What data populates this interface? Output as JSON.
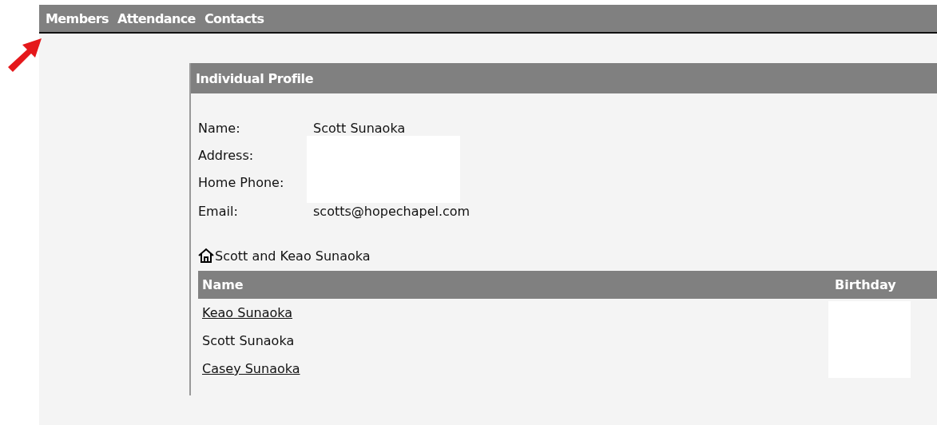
{
  "nav": [
    {
      "label": "Members"
    },
    {
      "label": "Attendance"
    },
    {
      "label": "Contacts"
    }
  ],
  "panel": {
    "title": "Individual Profile",
    "fields": [
      {
        "label": "Name:",
        "value": "Scott Sunaoka",
        "kind": "text"
      },
      {
        "label": "Address:",
        "kind": "redacted"
      },
      {
        "label": "Home Phone:",
        "kind": "redacted-end"
      },
      {
        "label": "Email:",
        "value": "scotts@hopechapel.com",
        "kind": "text"
      }
    ],
    "household": "Scott and Keao Sunaoka",
    "table": {
      "columns": [
        "Name",
        "Birthday"
      ],
      "rows": [
        {
          "name": "Keao Sunaoka",
          "link": true
        },
        {
          "name": "Scott Sunaoka",
          "link": false
        },
        {
          "name": "Casey Sunaoka",
          "link": true
        }
      ]
    }
  }
}
